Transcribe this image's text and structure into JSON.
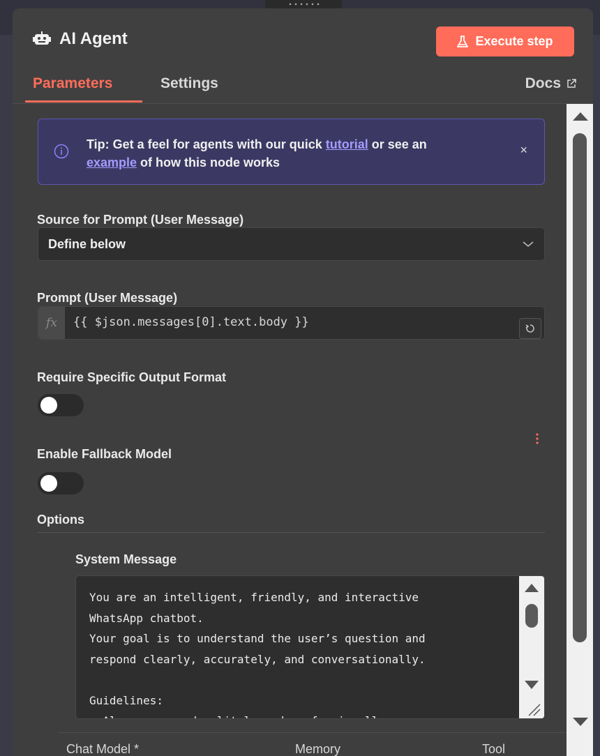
{
  "header": {
    "title": "AI Agent",
    "execute_label": "Execute step",
    "tabs": [
      {
        "label": "Parameters",
        "active": true
      },
      {
        "label": "Settings",
        "active": false
      }
    ],
    "docs_label": "Docs"
  },
  "tip": {
    "prefix": "Tip: Get a feel for agents with our quick ",
    "link1": "tutorial",
    "middle": " or see an ",
    "link2": "example",
    "suffix": " of how this node works",
    "close": "×"
  },
  "fields": {
    "source_label": "Source for Prompt (User Message)",
    "source_value": "Define below",
    "prompt_label": "Prompt (User Message)",
    "fx_label": "fx",
    "prompt_value": "{{ $json.messages[0].text.body }}",
    "output_format_label": "Require Specific Output Format",
    "output_format_on": false,
    "fallback_label": "Enable Fallback Model",
    "fallback_on": false
  },
  "options": {
    "label": "Options",
    "system_message_label": "System Message",
    "system_message_value": "You are an intelligent, friendly, and interactive\nWhatsApp chatbot.\nYour goal is to understand the user’s question and\nrespond clearly, accurately, and conversationally.\n\nGuidelines:\n- Always respond politely and professionally."
  },
  "footer": {
    "items": [
      "Chat Model *",
      "Memory",
      "Tool"
    ]
  },
  "colors": {
    "accent": "#ff6d5a",
    "tip_bg": "#3b3863",
    "tip_link": "#a49cff",
    "panel_bg": "#404040"
  }
}
